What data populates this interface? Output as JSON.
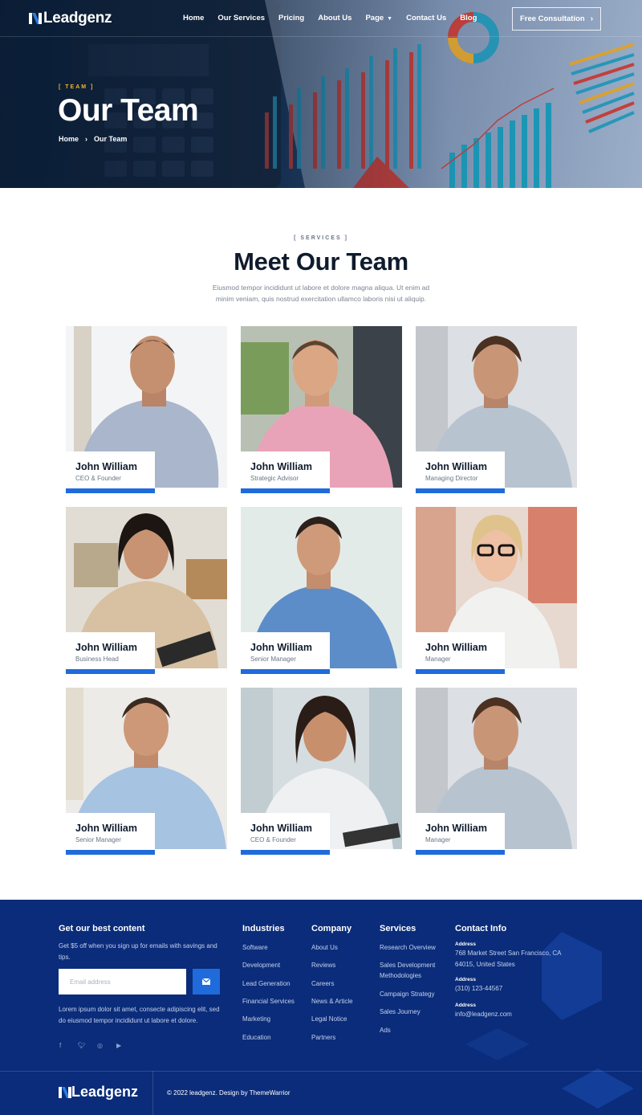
{
  "header": {
    "logo_text": "Leadgenz",
    "nav": [
      {
        "label": "Home"
      },
      {
        "label": "Our Services"
      },
      {
        "label": "Pricing"
      },
      {
        "label": "About Us"
      },
      {
        "label": "Page",
        "has_dropdown": true
      },
      {
        "label": "Contact Us"
      },
      {
        "label": "Blog"
      }
    ],
    "cta_label": "Free Consultation",
    "eyebrow": "[ TEAM ]",
    "title": "Our Team",
    "breadcrumb": [
      "Home",
      "Our Team"
    ]
  },
  "section": {
    "tag": "[ SERVICES ]",
    "title": "Meet Our Team",
    "description": "Eiusmod tempor incididunt ut labore et dolore magna aliqua. Ut enim ad minim veniam, quis nostrud exercitation ullamco laboris nisi ut aliquip."
  },
  "team": [
    {
      "name": "John William",
      "role": "CEO & Founder"
    },
    {
      "name": "John William",
      "role": "Strategic Advisor"
    },
    {
      "name": "John William",
      "role": "Managing Director"
    },
    {
      "name": "John William",
      "role": "Business Head"
    },
    {
      "name": "John William",
      "role": "Senior Manager"
    },
    {
      "name": "John William",
      "role": "Manager"
    },
    {
      "name": "John William",
      "role": "Senior Manager"
    },
    {
      "name": "John William",
      "role": "CEO & Founder"
    },
    {
      "name": "John William",
      "role": "Manager"
    }
  ],
  "footer": {
    "newsletter": {
      "heading": "Get our best content",
      "text": "Get $5 off when you sign up for emails with savings and tips.",
      "email_placeholder": "Email address",
      "about": "Lorem ipsum dolor sit amet, consecte adipiscing elit, sed do eiusmod tempor incididunt ut labore et dolore."
    },
    "industries": {
      "heading": "Industries",
      "links": [
        "Software",
        "Development",
        "Lead Generation",
        "Financial Services",
        "Marketing",
        "Education"
      ]
    },
    "company": {
      "heading": "Company",
      "links": [
        "About Us",
        "Reviews",
        "Careers",
        "News & Article",
        "Legal Notice",
        "Partners"
      ]
    },
    "services": {
      "heading": "Services",
      "links": [
        "Research Overview",
        "Sales Development Methodologies",
        "Campaign Strategy",
        "Sales Journey",
        "Ads"
      ]
    },
    "contact": {
      "heading": "Contact Info",
      "address_label": "Address",
      "address": "768 Market Street San Francisco, CA 64015, United States",
      "phone_label": "Address",
      "phone": "(310) 123-44567",
      "email_label": "Address",
      "email": "info@leadgenz.com"
    },
    "social_icons": [
      "facebook-icon",
      "twitter-icon",
      "instagram-icon",
      "youtube-icon"
    ],
    "logo_text": "Leadgenz",
    "copyright": "© 2022 leadgenz. Design by ThemeWarrior"
  },
  "colors": {
    "primary": "#1f6bdc",
    "navy": "#0a2c7a",
    "accent": "#f4b623",
    "heading": "#0f1b2d"
  }
}
